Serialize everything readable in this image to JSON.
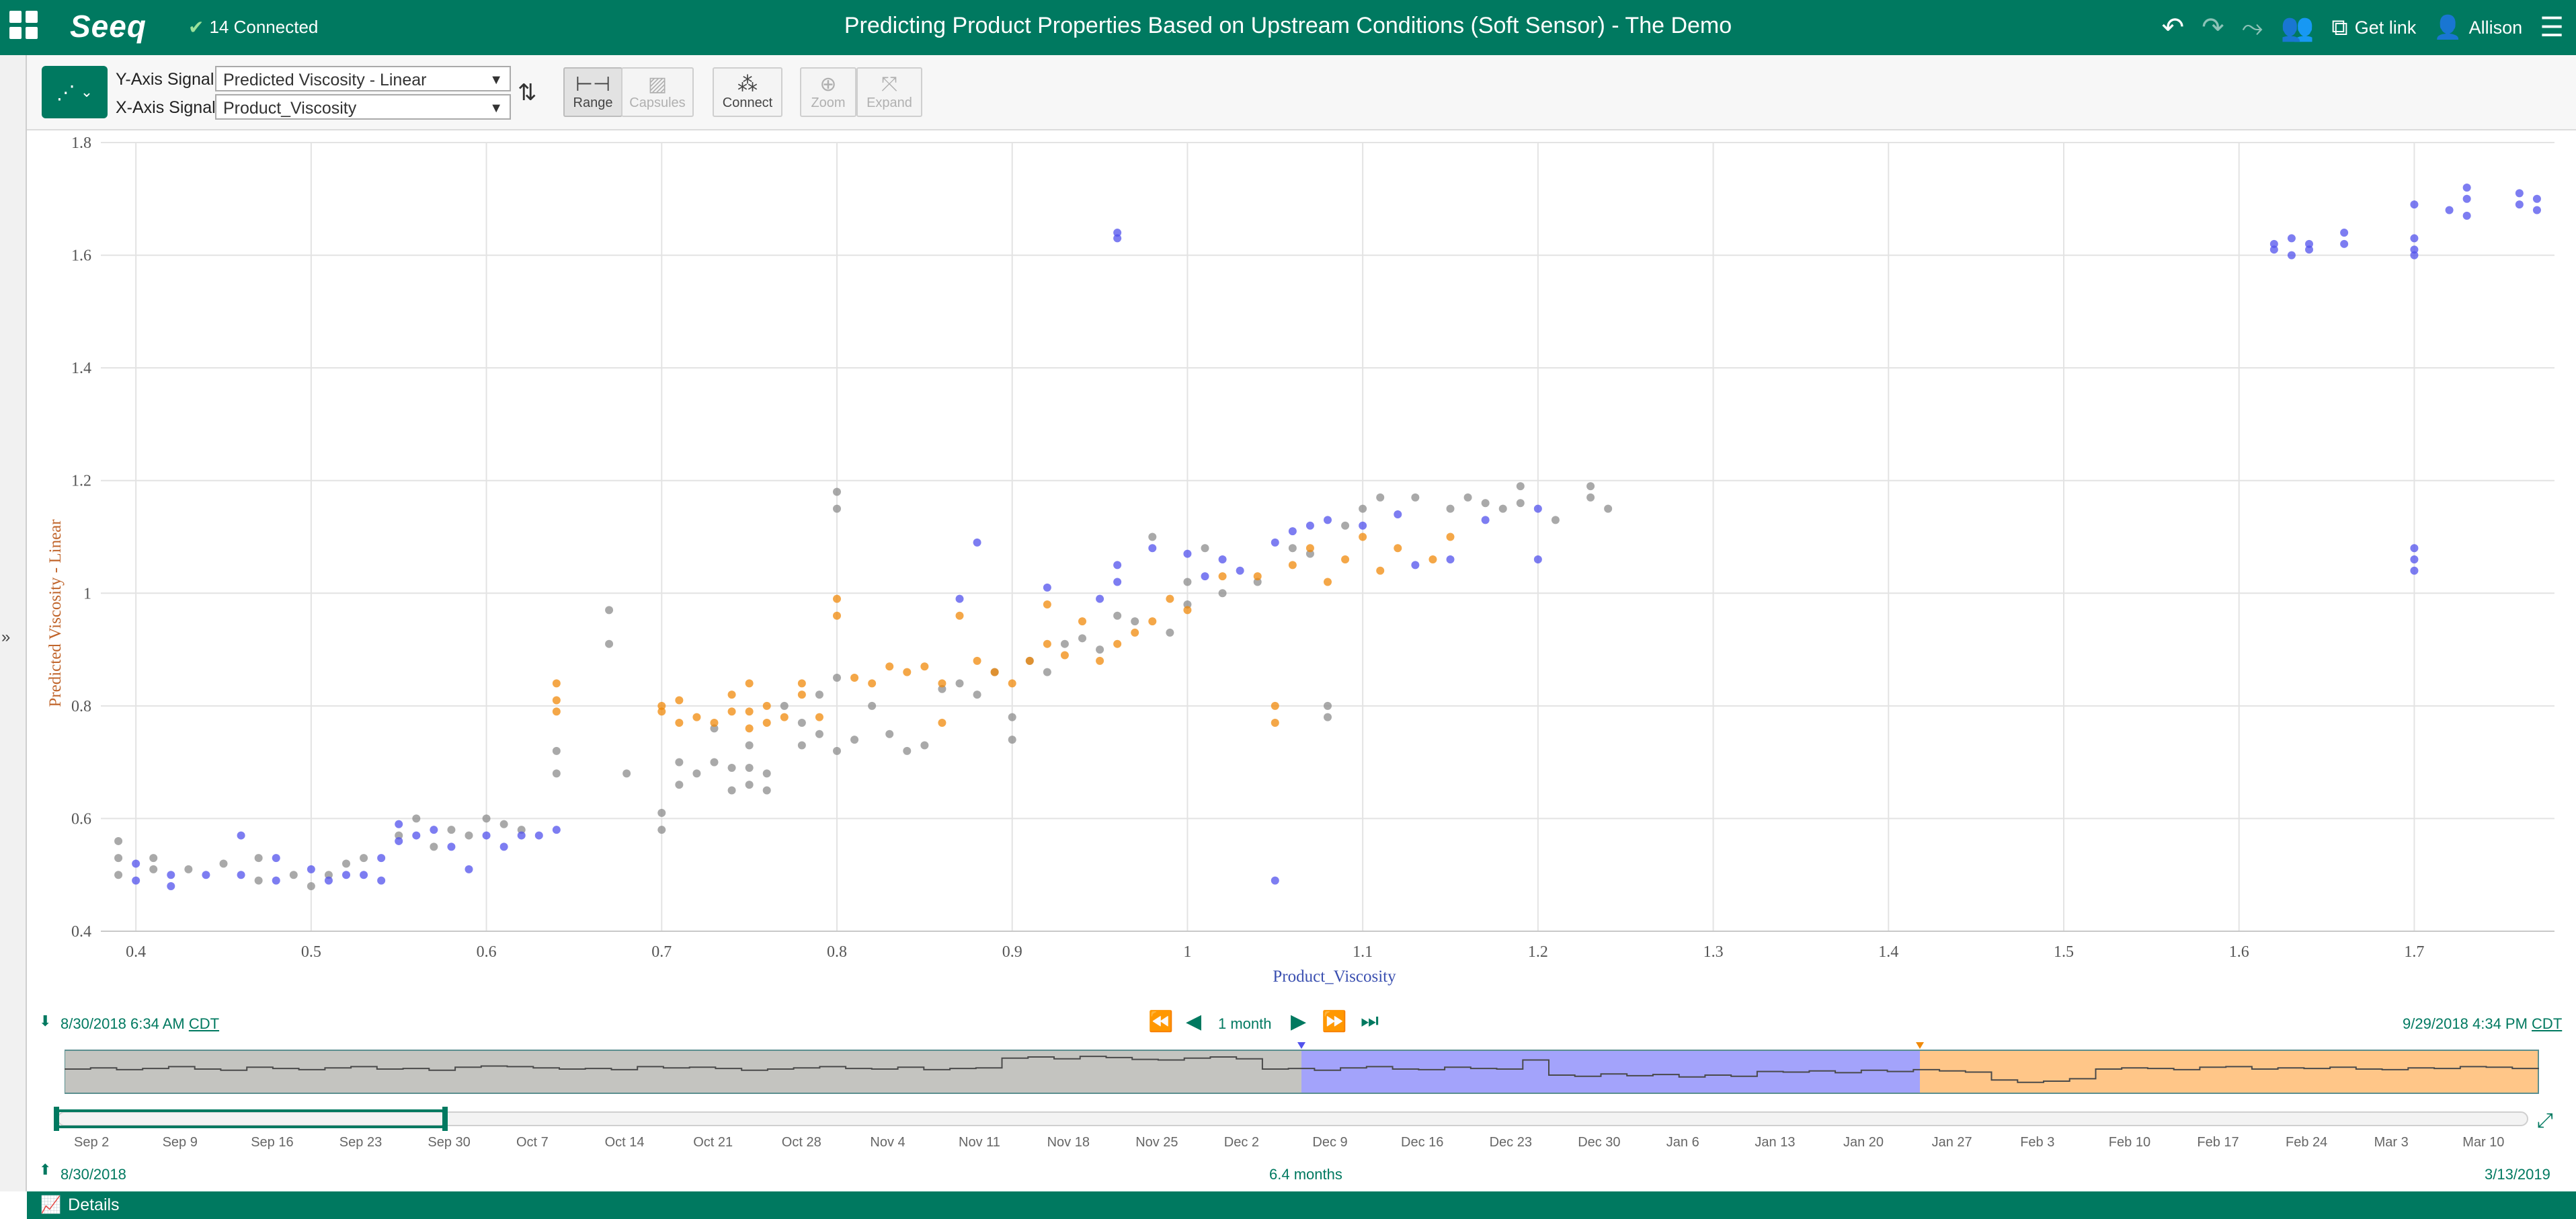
{
  "header": {
    "logo": "Seeq",
    "connection_status": "14 Connected",
    "title": "Predicting Product Properties Based on Upstream Conditions (Soft Sensor) - The Demo",
    "get_link_label": "Get link",
    "user_name": "Allison"
  },
  "toolbar": {
    "y_axis_label": "Y-Axis Signal:",
    "y_axis_value": "Predicted Viscosity - Linear",
    "x_axis_label": "X-Axis Signal:",
    "x_axis_value": "Product_Viscosity",
    "range_label": "Range",
    "capsules_label": "Capsules",
    "connect_label": "Connect",
    "zoom_label": "Zoom",
    "expand_label": "Expand"
  },
  "timeline": {
    "display_start": "8/30/2018 6:34 AM",
    "display_end": "9/29/2018 4:34 PM",
    "tz": "CDT",
    "duration_label": "1 month",
    "investigate_start": "8/30/2018",
    "investigate_end": "3/13/2019",
    "investigate_duration": "6.4 months",
    "tick_labels": [
      "Sep 2",
      "Sep 9",
      "Sep 16",
      "Sep 23",
      "Sep 30",
      "Oct 7",
      "Oct 14",
      "Oct 21",
      "Oct 28",
      "Nov 4",
      "Nov 11",
      "Nov 18",
      "Nov 25",
      "Dec 2",
      "Dec 9",
      "Dec 16",
      "Dec 23",
      "Dec 30",
      "Jan 6",
      "Jan 13",
      "Jan 20",
      "Jan 27",
      "Feb 3",
      "Feb 10",
      "Feb 17",
      "Feb 24",
      "Mar 3",
      "Mar 10"
    ],
    "colors": {
      "gray": "#c4c4c0",
      "blue": "#a3a3fb",
      "orange": "#ffc688"
    }
  },
  "footer": {
    "details_label": "Details"
  },
  "chart_data": {
    "type": "scatter",
    "xlabel": "Product_Viscosity",
    "ylabel": "Predicted Viscosity - Linear",
    "xlim": [
      0.38,
      1.78
    ],
    "ylim": [
      0.4,
      1.8
    ],
    "xticks": [
      0.4,
      0.5,
      0.6,
      0.7,
      0.8,
      0.9,
      1,
      1.1,
      1.2,
      1.3,
      1.4,
      1.5,
      1.6,
      1.7
    ],
    "yticks": [
      0.4,
      0.6,
      0.8,
      1,
      1.2,
      1.4,
      1.6,
      1.8
    ],
    "grid": true,
    "series": [
      {
        "color": "#8c8c8c",
        "points": [
          [
            0.39,
            0.5
          ],
          [
            0.39,
            0.53
          ],
          [
            0.39,
            0.56
          ],
          [
            0.41,
            0.51
          ],
          [
            0.41,
            0.53
          ],
          [
            0.43,
            0.51
          ],
          [
            0.45,
            0.52
          ],
          [
            0.47,
            0.49
          ],
          [
            0.47,
            0.53
          ],
          [
            0.49,
            0.5
          ],
          [
            0.5,
            0.48
          ],
          [
            0.51,
            0.5
          ],
          [
            0.52,
            0.52
          ],
          [
            0.53,
            0.53
          ],
          [
            0.55,
            0.57
          ],
          [
            0.56,
            0.6
          ],
          [
            0.57,
            0.55
          ],
          [
            0.58,
            0.58
          ],
          [
            0.59,
            0.57
          ],
          [
            0.6,
            0.6
          ],
          [
            0.61,
            0.59
          ],
          [
            0.62,
            0.58
          ],
          [
            0.64,
            0.68
          ],
          [
            0.64,
            0.72
          ],
          [
            0.67,
            0.91
          ],
          [
            0.67,
            0.97
          ],
          [
            0.68,
            0.68
          ],
          [
            0.7,
            0.58
          ],
          [
            0.7,
            0.61
          ],
          [
            0.71,
            0.66
          ],
          [
            0.71,
            0.7
          ],
          [
            0.72,
            0.68
          ],
          [
            0.73,
            0.7
          ],
          [
            0.73,
            0.76
          ],
          [
            0.74,
            0.65
          ],
          [
            0.74,
            0.69
          ],
          [
            0.75,
            0.66
          ],
          [
            0.75,
            0.69
          ],
          [
            0.75,
            0.73
          ],
          [
            0.76,
            0.65
          ],
          [
            0.76,
            0.68
          ],
          [
            0.77,
            0.8
          ],
          [
            0.78,
            0.73
          ],
          [
            0.78,
            0.77
          ],
          [
            0.79,
            0.75
          ],
          [
            0.79,
            0.82
          ],
          [
            0.8,
            0.85
          ],
          [
            0.8,
            1.15
          ],
          [
            0.8,
            1.18
          ],
          [
            0.8,
            0.72
          ],
          [
            0.81,
            0.74
          ],
          [
            0.82,
            0.8
          ],
          [
            0.83,
            0.75
          ],
          [
            0.84,
            0.72
          ],
          [
            0.85,
            0.73
          ],
          [
            0.86,
            0.83
          ],
          [
            0.87,
            0.84
          ],
          [
            0.88,
            0.82
          ],
          [
            0.89,
            0.86
          ],
          [
            0.9,
            0.74
          ],
          [
            0.9,
            0.78
          ],
          [
            0.91,
            0.88
          ],
          [
            0.92,
            0.86
          ],
          [
            0.93,
            0.91
          ],
          [
            0.94,
            0.92
          ],
          [
            0.95,
            0.9
          ],
          [
            0.96,
            0.96
          ],
          [
            0.97,
            0.95
          ],
          [
            0.98,
            1.1
          ],
          [
            0.99,
            0.93
          ],
          [
            1.0,
            1.02
          ],
          [
            1.0,
            0.98
          ],
          [
            1.01,
            1.08
          ],
          [
            1.02,
            1.0
          ],
          [
            1.04,
            1.02
          ],
          [
            1.06,
            1.08
          ],
          [
            1.07,
            1.07
          ],
          [
            1.08,
            0.78
          ],
          [
            1.08,
            0.8
          ],
          [
            1.09,
            1.12
          ],
          [
            1.1,
            1.15
          ],
          [
            1.11,
            1.17
          ],
          [
            1.13,
            1.17
          ],
          [
            1.15,
            1.15
          ],
          [
            1.16,
            1.17
          ],
          [
            1.17,
            1.16
          ],
          [
            1.18,
            1.15
          ],
          [
            1.19,
            1.19
          ],
          [
            1.19,
            1.16
          ],
          [
            1.21,
            1.13
          ],
          [
            1.23,
            1.17
          ],
          [
            1.23,
            1.19
          ],
          [
            1.24,
            1.15
          ]
        ]
      },
      {
        "color": "#5252ec",
        "points": [
          [
            0.4,
            0.52
          ],
          [
            0.4,
            0.49
          ],
          [
            0.42,
            0.5
          ],
          [
            0.42,
            0.48
          ],
          [
            0.44,
            0.5
          ],
          [
            0.46,
            0.5
          ],
          [
            0.46,
            0.57
          ],
          [
            0.48,
            0.53
          ],
          [
            0.48,
            0.49
          ],
          [
            0.5,
            0.51
          ],
          [
            0.51,
            0.49
          ],
          [
            0.52,
            0.5
          ],
          [
            0.53,
            0.5
          ],
          [
            0.54,
            0.49
          ],
          [
            0.54,
            0.53
          ],
          [
            0.55,
            0.56
          ],
          [
            0.55,
            0.59
          ],
          [
            0.56,
            0.57
          ],
          [
            0.57,
            0.58
          ],
          [
            0.58,
            0.55
          ],
          [
            0.59,
            0.51
          ],
          [
            0.6,
            0.57
          ],
          [
            0.61,
            0.55
          ],
          [
            0.62,
            0.57
          ],
          [
            0.63,
            0.57
          ],
          [
            0.64,
            0.58
          ],
          [
            0.87,
            0.99
          ],
          [
            0.88,
            1.09
          ],
          [
            0.92,
            1.01
          ],
          [
            0.95,
            0.99
          ],
          [
            0.96,
            1.02
          ],
          [
            0.96,
            1.05
          ],
          [
            0.96,
            1.63
          ],
          [
            0.96,
            1.64
          ],
          [
            0.98,
            1.08
          ],
          [
            1.0,
            1.07
          ],
          [
            1.01,
            1.03
          ],
          [
            1.02,
            1.06
          ],
          [
            1.03,
            1.04
          ],
          [
            1.05,
            0.49
          ],
          [
            1.05,
            1.09
          ],
          [
            1.06,
            1.11
          ],
          [
            1.07,
            1.12
          ],
          [
            1.08,
            1.13
          ],
          [
            1.1,
            1.12
          ],
          [
            1.12,
            1.14
          ],
          [
            1.13,
            1.05
          ],
          [
            1.15,
            1.06
          ],
          [
            1.17,
            1.13
          ],
          [
            1.2,
            1.06
          ],
          [
            1.2,
            1.15
          ],
          [
            1.62,
            1.61
          ],
          [
            1.62,
            1.62
          ],
          [
            1.63,
            1.6
          ],
          [
            1.63,
            1.63
          ],
          [
            1.64,
            1.61
          ],
          [
            1.64,
            1.62
          ],
          [
            1.66,
            1.62
          ],
          [
            1.66,
            1.64
          ],
          [
            1.7,
            1.6
          ],
          [
            1.7,
            1.61
          ],
          [
            1.7,
            1.63
          ],
          [
            1.7,
            1.69
          ],
          [
            1.7,
            1.04
          ],
          [
            1.7,
            1.06
          ],
          [
            1.7,
            1.08
          ],
          [
            1.72,
            1.68
          ],
          [
            1.73,
            1.67
          ],
          [
            1.73,
            1.7
          ],
          [
            1.73,
            1.72
          ],
          [
            1.76,
            1.69
          ],
          [
            1.76,
            1.71
          ],
          [
            1.77,
            1.68
          ],
          [
            1.77,
            1.7
          ]
        ]
      },
      {
        "color": "#f08a0b",
        "points": [
          [
            0.64,
            0.79
          ],
          [
            0.64,
            0.81
          ],
          [
            0.64,
            0.84
          ],
          [
            0.7,
            0.79
          ],
          [
            0.7,
            0.8
          ],
          [
            0.71,
            0.77
          ],
          [
            0.71,
            0.81
          ],
          [
            0.72,
            0.78
          ],
          [
            0.73,
            0.77
          ],
          [
            0.74,
            0.79
          ],
          [
            0.74,
            0.82
          ],
          [
            0.75,
            0.76
          ],
          [
            0.75,
            0.79
          ],
          [
            0.75,
            0.84
          ],
          [
            0.76,
            0.77
          ],
          [
            0.76,
            0.8
          ],
          [
            0.77,
            0.78
          ],
          [
            0.78,
            0.82
          ],
          [
            0.78,
            0.84
          ],
          [
            0.79,
            0.78
          ],
          [
            0.8,
            0.96
          ],
          [
            0.8,
            0.99
          ],
          [
            0.81,
            0.85
          ],
          [
            0.82,
            0.84
          ],
          [
            0.83,
            0.87
          ],
          [
            0.84,
            0.86
          ],
          [
            0.85,
            0.87
          ],
          [
            0.86,
            0.77
          ],
          [
            0.86,
            0.84
          ],
          [
            0.87,
            0.96
          ],
          [
            0.88,
            0.88
          ],
          [
            0.89,
            0.86
          ],
          [
            0.9,
            0.84
          ],
          [
            0.91,
            0.88
          ],
          [
            0.92,
            0.98
          ],
          [
            0.92,
            0.91
          ],
          [
            0.93,
            0.89
          ],
          [
            0.94,
            0.95
          ],
          [
            0.95,
            0.88
          ],
          [
            0.96,
            0.91
          ],
          [
            0.97,
            0.93
          ],
          [
            0.98,
            0.95
          ],
          [
            0.99,
            0.99
          ],
          [
            1.0,
            0.97
          ],
          [
            1.02,
            1.03
          ],
          [
            1.04,
            1.03
          ],
          [
            1.05,
            0.77
          ],
          [
            1.05,
            0.8
          ],
          [
            1.06,
            1.05
          ],
          [
            1.07,
            1.08
          ],
          [
            1.08,
            1.02
          ],
          [
            1.09,
            1.06
          ],
          [
            1.1,
            1.1
          ],
          [
            1.11,
            1.04
          ],
          [
            1.12,
            1.08
          ],
          [
            1.14,
            1.06
          ],
          [
            1.15,
            1.1
          ]
        ]
      }
    ]
  }
}
